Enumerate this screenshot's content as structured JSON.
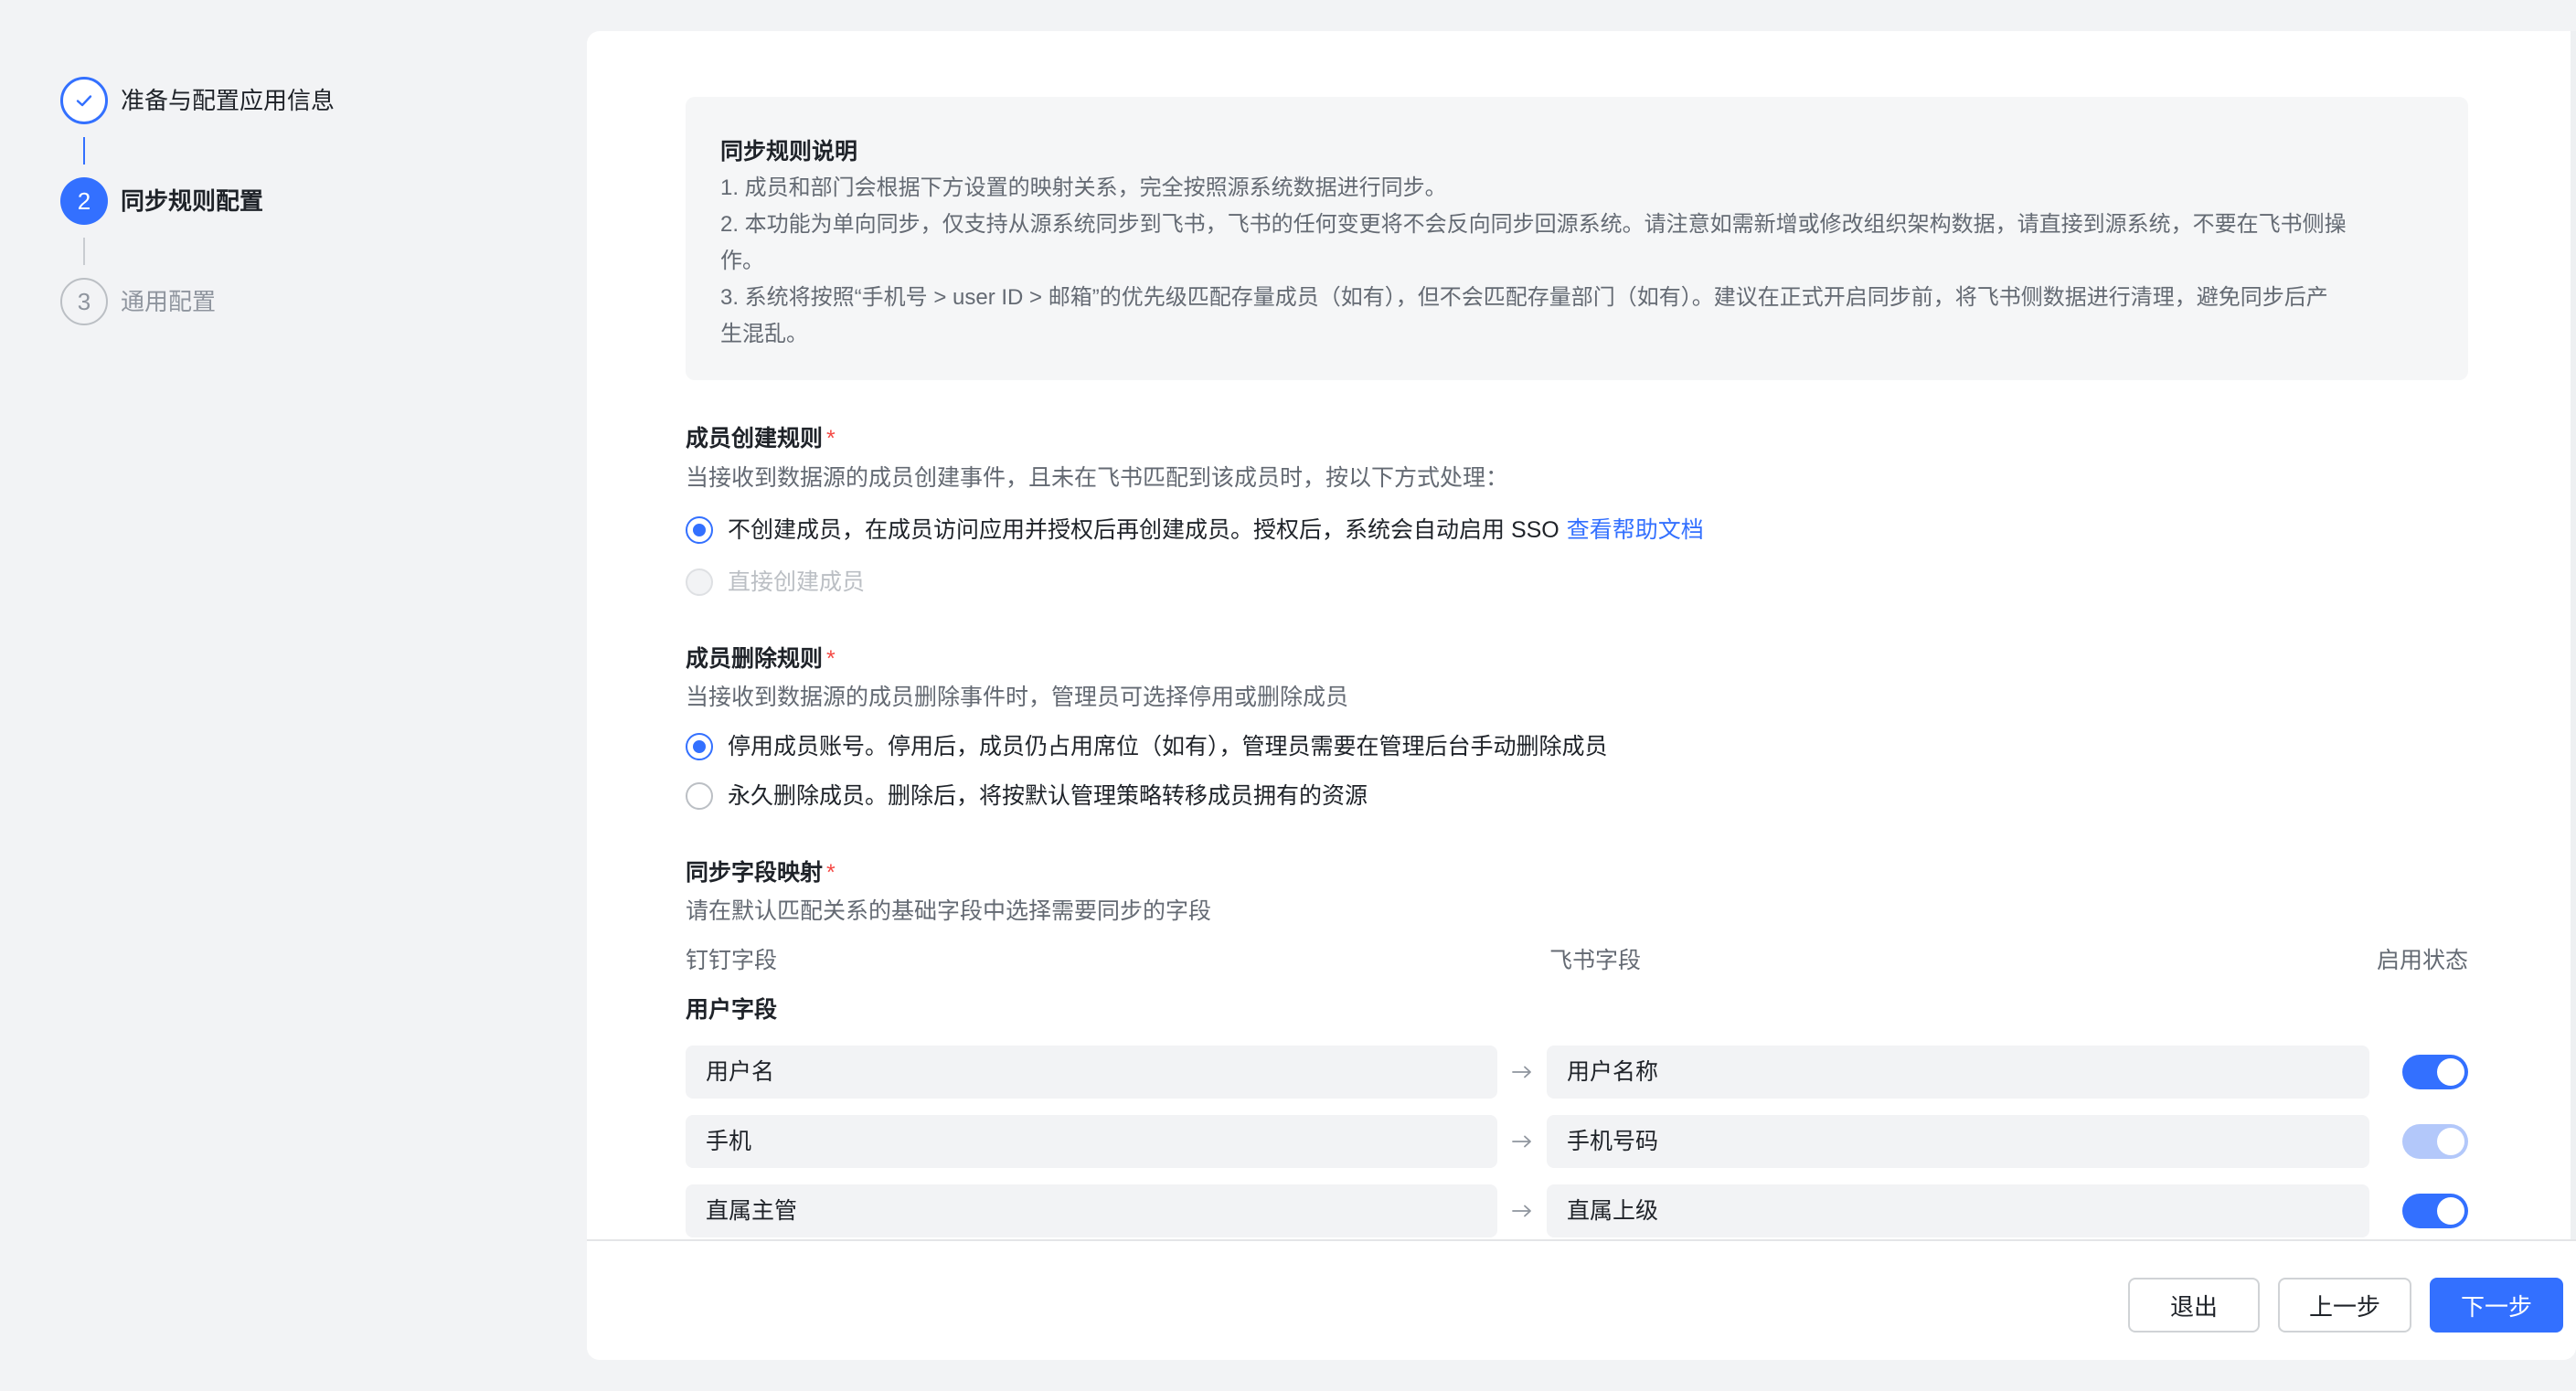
{
  "stepper": {
    "steps": [
      {
        "number": "1",
        "label": "准备与配置应用信息",
        "state": "done"
      },
      {
        "number": "2",
        "label": "同步规则配置",
        "state": "active"
      },
      {
        "number": "3",
        "label": "通用配置",
        "state": "pending"
      }
    ]
  },
  "info": {
    "title": "同步规则说明",
    "lines": [
      "1. 成员和部门会根据下方设置的映射关系，完全按照源系统数据进行同步。",
      "2. 本功能为单向同步，仅支持从源系统同步到飞书，飞书的任何变更将不会反向同步回源系统。请注意如需新增或修改组织架构数据，请直接到源系统，不要在飞书侧操",
      "作。",
      "3. 系统将按照“手机号 > user ID > 邮箱”的优先级匹配存量成员（如有），但不会匹配存量部门（如有）。建议在正式开启同步前，将飞书侧数据进行清理，避免同步后产",
      "生混乱。"
    ]
  },
  "create_rule": {
    "title": "成员创建规则",
    "required_mark": "*",
    "description": "当接收到数据源的成员创建事件，且未在飞书匹配到该成员时，按以下方式处理：",
    "options": [
      {
        "label": "不创建成员，在成员访问应用并授权后再创建成员。授权后，系统会自动启用 SSO",
        "link": "查看帮助文档",
        "checked": true,
        "disabled": false
      },
      {
        "label": "直接创建成员",
        "checked": false,
        "disabled": true
      }
    ]
  },
  "delete_rule": {
    "title": "成员删除规则",
    "required_mark": "*",
    "description": "当接收到数据源的成员删除事件时，管理员可选择停用或删除成员",
    "options": [
      {
        "label": "停用成员账号。停用后，成员仍占用席位（如有），管理员需要在管理后台手动删除成员",
        "checked": true
      },
      {
        "label": "永久删除成员。删除后，将按默认管理策略转移成员拥有的资源",
        "checked": false
      }
    ]
  },
  "field_mapping": {
    "title": "同步字段映射",
    "required_mark": "*",
    "description": "请在默认匹配关系的基础字段中选择需要同步的字段",
    "columns": {
      "source": "钉钉字段",
      "target": "飞书字段",
      "status": "启用状态"
    },
    "group_title": "用户字段",
    "rows": [
      {
        "source": "用户名",
        "target": "用户名称",
        "enabled": true,
        "locked": false
      },
      {
        "source": "手机",
        "target": "手机号码",
        "enabled": true,
        "locked": true
      },
      {
        "source": "直属主管",
        "target": "直属上级",
        "enabled": true,
        "locked": false
      }
    ]
  },
  "footer": {
    "exit_label": "退出",
    "prev_label": "上一步",
    "next_label": "下一步"
  },
  "colors": {
    "primary": "#3370ff",
    "required": "#f54a45",
    "muted_text": "#646a73"
  }
}
